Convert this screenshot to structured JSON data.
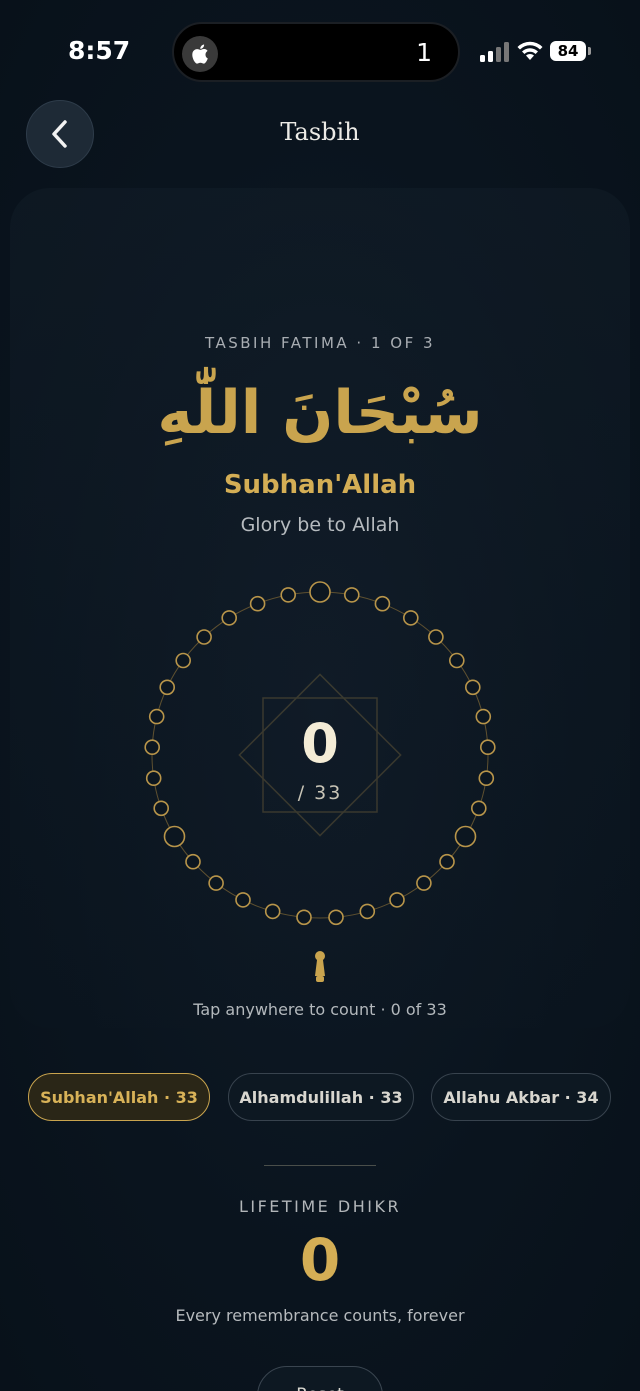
{
  "status_bar": {
    "time": "8:57",
    "island_count": "1",
    "battery": "84"
  },
  "header": {
    "title": "Tasbih",
    "back_icon": "chevron-left-icon"
  },
  "dhikr": {
    "sequence_label": "TASBIH FATIMA · 1 OF 3",
    "arabic": "سُبْحَانَ اللّٰهِ",
    "transliteration": "Subhan'Allah",
    "meaning": "Glory be to Allah"
  },
  "counter": {
    "count": "0",
    "total_label": "/ 33",
    "current": 0,
    "target": 33,
    "hint": "Tap anywhere to count · 0 of 33"
  },
  "chips": [
    {
      "label": "Subhan'Allah · 33",
      "active": true
    },
    {
      "label": "Alhamdulillah · 33",
      "active": false
    },
    {
      "label": "Allahu Akbar · 34",
      "active": false
    }
  ],
  "lifetime": {
    "label": "LIFETIME DHIKR",
    "count": "0",
    "caption": "Every remembrance counts, forever"
  },
  "reset": {
    "label": "Reset"
  },
  "colors": {
    "gold": "#c9a44e",
    "background": "#0b1520",
    "bead_stroke": "#b8954a"
  }
}
